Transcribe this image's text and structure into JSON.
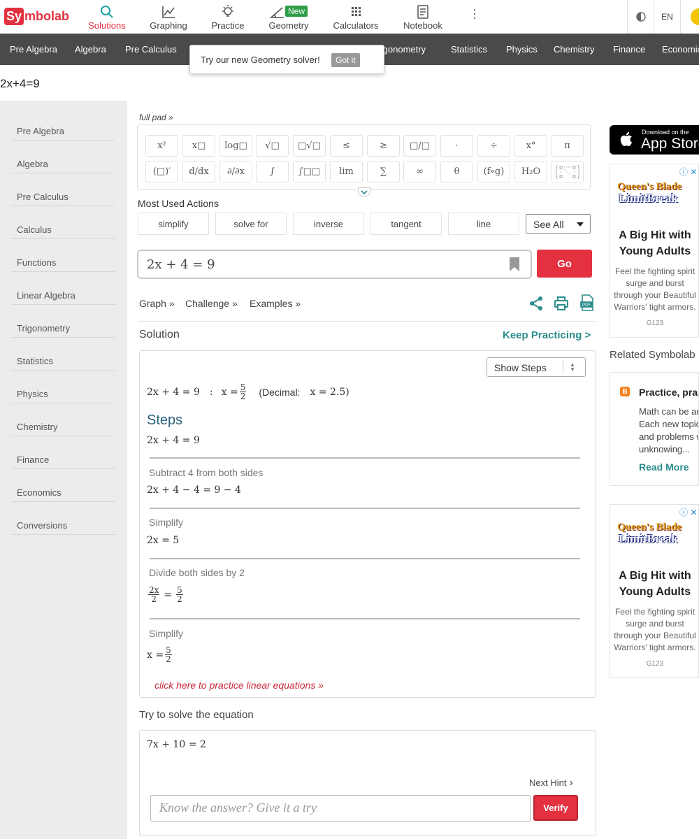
{
  "brand": {
    "logo_left": "Sy",
    "logo_right": "mbolab"
  },
  "topnav": {
    "items": [
      {
        "label": "Solutions",
        "icon": "search-icon"
      },
      {
        "label": "Graphing",
        "icon": "graph-icon"
      },
      {
        "label": "Practice",
        "icon": "lightbulb-icon"
      },
      {
        "label": "Geometry",
        "icon": "angle-icon",
        "badge": "New"
      },
      {
        "label": "Calculators",
        "icon": "calculator-icon"
      },
      {
        "label": "Notebook",
        "icon": "notebook-icon"
      }
    ],
    "language": "EN"
  },
  "subjects": [
    "Pre Algebra",
    "Algebra",
    "Pre Calculus",
    "Trigonometry",
    "Statistics",
    "Physics",
    "Chemistry",
    "Finance",
    "Economics"
  ],
  "tooltip": {
    "text": "Try our new Geometry solver!",
    "button": "Got it"
  },
  "query_title": "2x+4=9",
  "sidebar": [
    "Pre Algebra",
    "Algebra",
    "Pre Calculus",
    "Calculus",
    "Functions",
    "Linear Algebra",
    "Trigonometry",
    "Statistics",
    "Physics",
    "Chemistry",
    "Finance",
    "Economics",
    "Conversions"
  ],
  "full_pad": "full pad »",
  "keypad_row1": [
    "x²",
    "x□",
    "log□",
    "√□",
    "□√□",
    "≤",
    "≥",
    "□/□",
    "·",
    "÷",
    "x°",
    "π"
  ],
  "keypad_row2": [
    "(□)′",
    "d/dx",
    "∂/∂x",
    "∫",
    "∫□□",
    "lim",
    "∑",
    "∞",
    "θ",
    "(f∘g)",
    "H₂O",
    "matrix"
  ],
  "most_used": {
    "title": "Most Used Actions",
    "actions": [
      "simplify",
      "solve for",
      "inverse",
      "tangent",
      "line"
    ],
    "see_all": "See All"
  },
  "input": {
    "value": "2x + 4 = 9",
    "go": "Go"
  },
  "links": {
    "graph": "Graph »",
    "challenge": "Challenge »",
    "examples": "Examples »"
  },
  "solution": {
    "title": "Solution",
    "keep_practicing": "Keep Practicing >",
    "show_steps": "Show Steps",
    "answer_eq": "2x + 4 = 9",
    "answer_sep": ":",
    "answer_x": "x =",
    "answer_num": "5",
    "answer_den": "2",
    "decimal_label": "(Decimal:",
    "decimal_value": "x = 2.5)",
    "steps_title": "Steps",
    "first_eq": "2x + 4 = 9",
    "steps": [
      {
        "label": "Subtract 4 from both sides",
        "eq": "2x + 4 − 4 = 9 − 4"
      },
      {
        "label": "Simplify",
        "eq": "2x = 5"
      },
      {
        "label": "Divide both sides by 2",
        "eq_l_num": "2x",
        "eq_l_den": "2",
        "eq_mid": "=",
        "eq_r_num": "5",
        "eq_r_den": "2"
      },
      {
        "label": "Simplify",
        "eq_l": "x =",
        "eq_r_num": "5",
        "eq_r_den": "2"
      }
    ],
    "practice_link": "click here to practice linear equations »"
  },
  "try": {
    "title": "Try to solve the equation",
    "equation": "7x + 10 = 2",
    "next_hint": "Next Hint",
    "placeholder": "Know the answer? Give it a try",
    "verify": "Verify"
  },
  "appstore": {
    "small": "Download on the",
    "large": "App Store"
  },
  "ad": {
    "logo_line1": "Queen's Blade",
    "logo_line2": "LimitBreak",
    "headline_1": "A Big Hit with",
    "headline_2": "Young Adults",
    "body_1": "Feel the fighting spirit",
    "body_2": "surge and burst",
    "body_3": "through your Beautiful",
    "body_4": "Warriors' tight armors.",
    "code": "G123"
  },
  "related": {
    "title": "Related Symbolab",
    "card_title": "Practice, prac",
    "lines": [
      "Math can be an",
      "Each new topic",
      "and problems w",
      "unknowing..."
    ],
    "read_more": "Read More"
  },
  "colors": {
    "accent_red": "#e3313f",
    "teal": "#2b8c8c",
    "nav_dark": "#4a4a4a",
    "new_badge": "#2e9e49"
  }
}
